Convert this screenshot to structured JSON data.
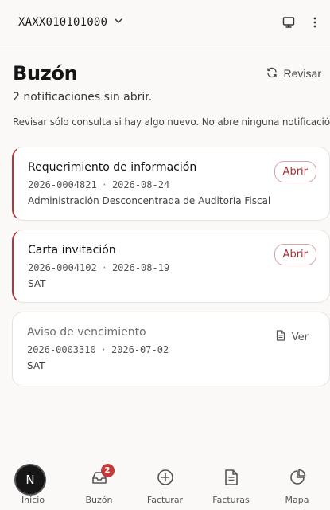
{
  "header": {
    "account_rfc": "XAXX010101000"
  },
  "page": {
    "title": "Buzón",
    "refresh_label": "Revisar",
    "subtitle": "2 notificaciones sin abrir.",
    "hint": "Revisar sólo consulta si hay algo nuevo. No abre ninguna notificación."
  },
  "notifications": [
    {
      "title": "Requerimiento de información",
      "folio": "2026-0004821",
      "date": "2026-08-24",
      "issuer": "Administración Desconcentrada de Auditoría Fiscal",
      "action": "Abrir",
      "status": "unread"
    },
    {
      "title": "Carta invitación",
      "folio": "2026-0004102",
      "date": "2026-08-19",
      "issuer": "SAT",
      "action": "Abrir",
      "status": "unread"
    },
    {
      "title": "Aviso de vencimiento",
      "folio": "2026-0003310",
      "date": "2026-07-02",
      "issuer": "SAT",
      "action": "Ver",
      "status": "read"
    }
  ],
  "nav": {
    "items": [
      {
        "label": "Inicio",
        "icon": "home-icon"
      },
      {
        "label": "Buzón",
        "icon": "inbox-icon",
        "badge": "2"
      },
      {
        "label": "Facturar",
        "icon": "plus-circle-icon"
      },
      {
        "label": "Facturas",
        "icon": "document-icon"
      },
      {
        "label": "Mapa",
        "icon": "pie-chart-icon"
      }
    ]
  },
  "avatar_initial": "N",
  "colors": {
    "accent": "#b8323a",
    "badge": "#c23a3a",
    "background": "#faf9f7"
  }
}
